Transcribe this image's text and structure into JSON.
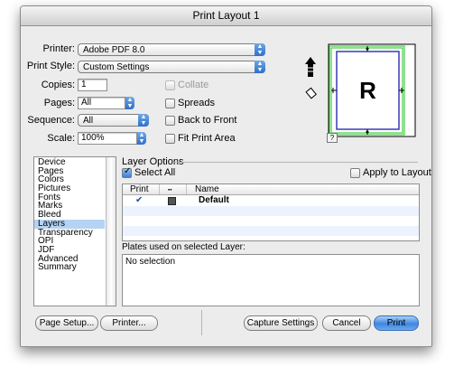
{
  "window": {
    "title": "Print Layout 1"
  },
  "printer": {
    "label": "Printer:",
    "value": "Adobe PDF 8.0"
  },
  "print_style": {
    "label": "Print Style:",
    "value": "Custom Settings"
  },
  "copies": {
    "label": "Copies:",
    "value": "1"
  },
  "collate": {
    "label": "Collate",
    "checked": false,
    "enabled": false
  },
  "pages": {
    "label": "Pages:",
    "value": "All"
  },
  "spreads": {
    "label": "Spreads",
    "checked": false
  },
  "sequence": {
    "label": "Sequence:",
    "value": "All"
  },
  "back_to_front": {
    "label": "Back to Front",
    "checked": false
  },
  "scale": {
    "label": "Scale:",
    "value": "100%"
  },
  "fit_print_area": {
    "label": "Fit Print Area",
    "checked": false
  },
  "preview": {
    "letter": "R",
    "help": "?"
  },
  "categories": [
    {
      "label": "Device",
      "selected": false
    },
    {
      "label": "Pages",
      "selected": false
    },
    {
      "label": "Colors",
      "selected": false
    },
    {
      "label": "Pictures",
      "selected": false
    },
    {
      "label": "Fonts",
      "selected": false
    },
    {
      "label": "Marks",
      "selected": false
    },
    {
      "label": "Bleed",
      "selected": false
    },
    {
      "label": "Layers",
      "selected": true
    },
    {
      "label": "Transparency",
      "selected": false
    },
    {
      "label": "OPI",
      "selected": false
    },
    {
      "label": "JDF",
      "selected": false
    },
    {
      "label": "Advanced",
      "selected": false
    },
    {
      "label": "Summary",
      "selected": false
    }
  ],
  "layer_options": {
    "group_title": "Layer Options",
    "select_all": {
      "label": "Select All",
      "checked": true
    },
    "apply_to_layout": {
      "label": "Apply to Layout",
      "checked": false
    },
    "columns": {
      "print": "Print",
      "name": "Name"
    },
    "rows": [
      {
        "print": true,
        "name": "Default"
      }
    ],
    "plates_label": "Plates used on selected Layer:",
    "plates_value": "No selection"
  },
  "buttons": {
    "page_setup": "Page Setup...",
    "printer": "Printer...",
    "capture_settings": "Capture Settings",
    "cancel": "Cancel",
    "print": "Print"
  }
}
